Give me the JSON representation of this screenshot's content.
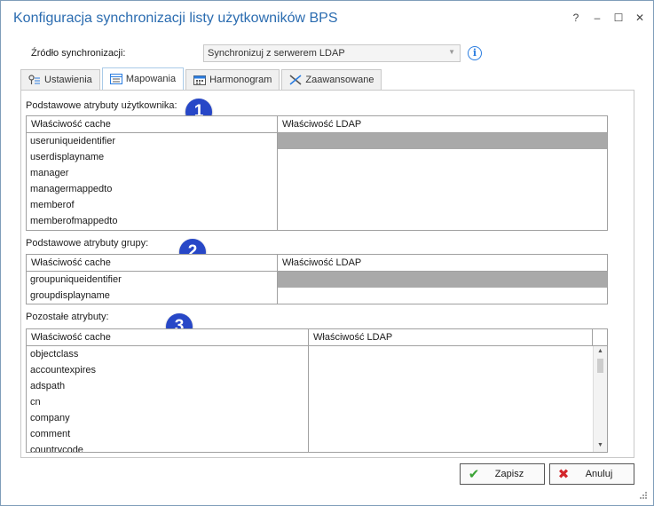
{
  "window": {
    "title": "Konfiguracja synchronizacji listy użytkowników BPS",
    "controls": {
      "help": "?",
      "minimize": "–",
      "maximize": "☐",
      "close": "✕"
    }
  },
  "source": {
    "label": "Źródło synchronizacji:",
    "value": "Synchronizuj z serwerem LDAP",
    "info_icon": "i"
  },
  "tabs": [
    {
      "label": "Ustawienia",
      "icon": "key-list-icon"
    },
    {
      "label": "Mapowania",
      "icon": "table-icon",
      "active": true
    },
    {
      "label": "Harmonogram",
      "icon": "calendar-icon"
    },
    {
      "label": "Zaawansowane",
      "icon": "tools-icon"
    }
  ],
  "sections": {
    "user": {
      "label": "Podstawowe atrybuty użytkownika:",
      "badge": "1",
      "col_cache": "Właściwość cache",
      "col_ldap": "Właściwość LDAP",
      "rows": [
        "useruniqueidentifier",
        "userdisplayname",
        "manager",
        "managermappedto",
        "memberof",
        "memberofmappedto"
      ]
    },
    "group": {
      "label": "Podstawowe atrybuty grupy:",
      "badge": "2",
      "col_cache": "Właściwość cache",
      "col_ldap": "Właściwość LDAP",
      "rows": [
        "groupuniqueidentifier",
        "groupdisplayname"
      ]
    },
    "other": {
      "label": "Pozostałe atrybuty:",
      "badge": "3",
      "col_cache": "Właściwość cache",
      "col_ldap": "Właściwość LDAP",
      "rows": [
        "objectclass",
        "accountexpires",
        "adspath",
        "cn",
        "company",
        "comment",
        "countrycode"
      ]
    }
  },
  "buttons": {
    "save": "Zapisz",
    "cancel": "Anuluj"
  },
  "colors": {
    "title": "#2b6cb0",
    "badge": "#2747c7",
    "selected_cell": "#a9a9a9",
    "save_icon": "#3aa335",
    "cancel_icon": "#d3262b"
  }
}
